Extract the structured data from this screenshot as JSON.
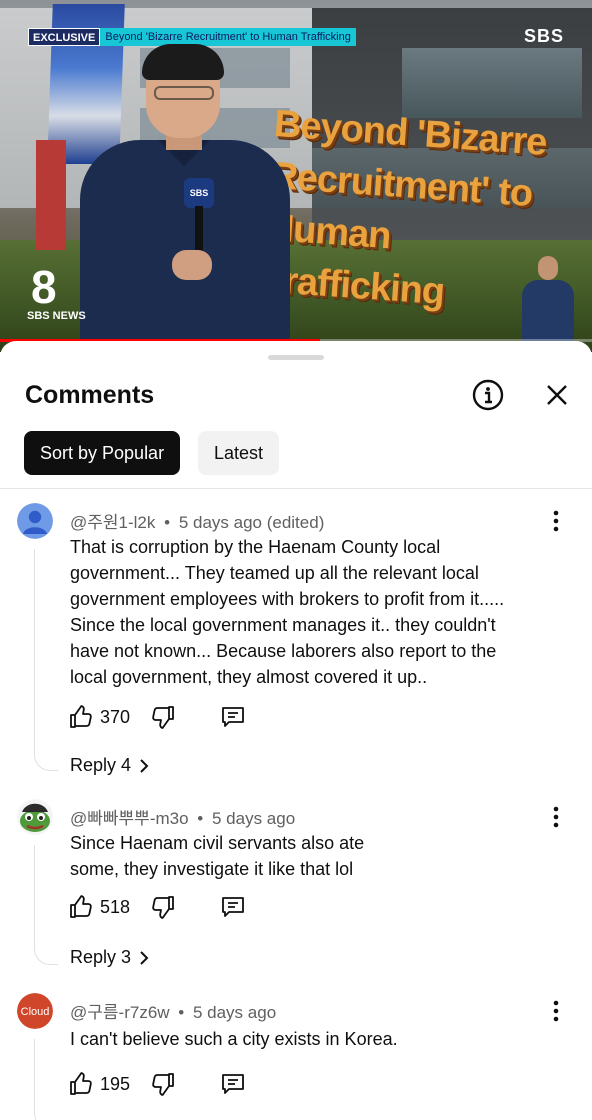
{
  "video": {
    "exclusive_tag": "EXCLUSIVE",
    "ticker_text": "Beyond 'Bizarre Recruitment' to Human Trafficking",
    "channel_logo": "SBS",
    "headline_line1": "Beyond 'Bizarre",
    "headline_line2": "Recruitment' to",
    "headline_line3": "Human Trafficking",
    "mic_label": "SBS",
    "news_number": "8",
    "news_label": "SBS NEWS",
    "progress_fraction": 0.54,
    "progress_color": "#ff0000"
  },
  "sheet": {
    "title": "Comments",
    "info_icon": "info-icon",
    "close_icon": "close-icon",
    "sort_popular": "Sort by Popular",
    "sort_latest": "Latest"
  },
  "comments": [
    {
      "author": "@주원1-l2k",
      "separator": "•",
      "time": "5 days ago (edited)",
      "text": "That is corruption by the Haenam County local government... They teamed up all the relevant local government employees with brokers to profit from it..... Since the local government manages it.. they couldn't have not known... Because laborers also report to the local government, they almost covered it up..",
      "likes": "370",
      "replies": "Reply 4",
      "avatar_color": "#6f9ae6"
    },
    {
      "author": "@빠빠뿌뿌-m3o",
      "separator": "•",
      "time": "5 days ago",
      "text": "Since Haenam civil servants also ate some, they investigate it like that lol",
      "likes": "518",
      "replies": "Reply 3",
      "avatar_color": "#4f9a3b"
    },
    {
      "author": "@구름-r7z6w",
      "separator": "•",
      "time": "5 days ago",
      "text": "I can't believe such a city exists in Korea.",
      "likes": "195",
      "avatar_label": "Cloud",
      "avatar_color": "#d0462a"
    }
  ]
}
